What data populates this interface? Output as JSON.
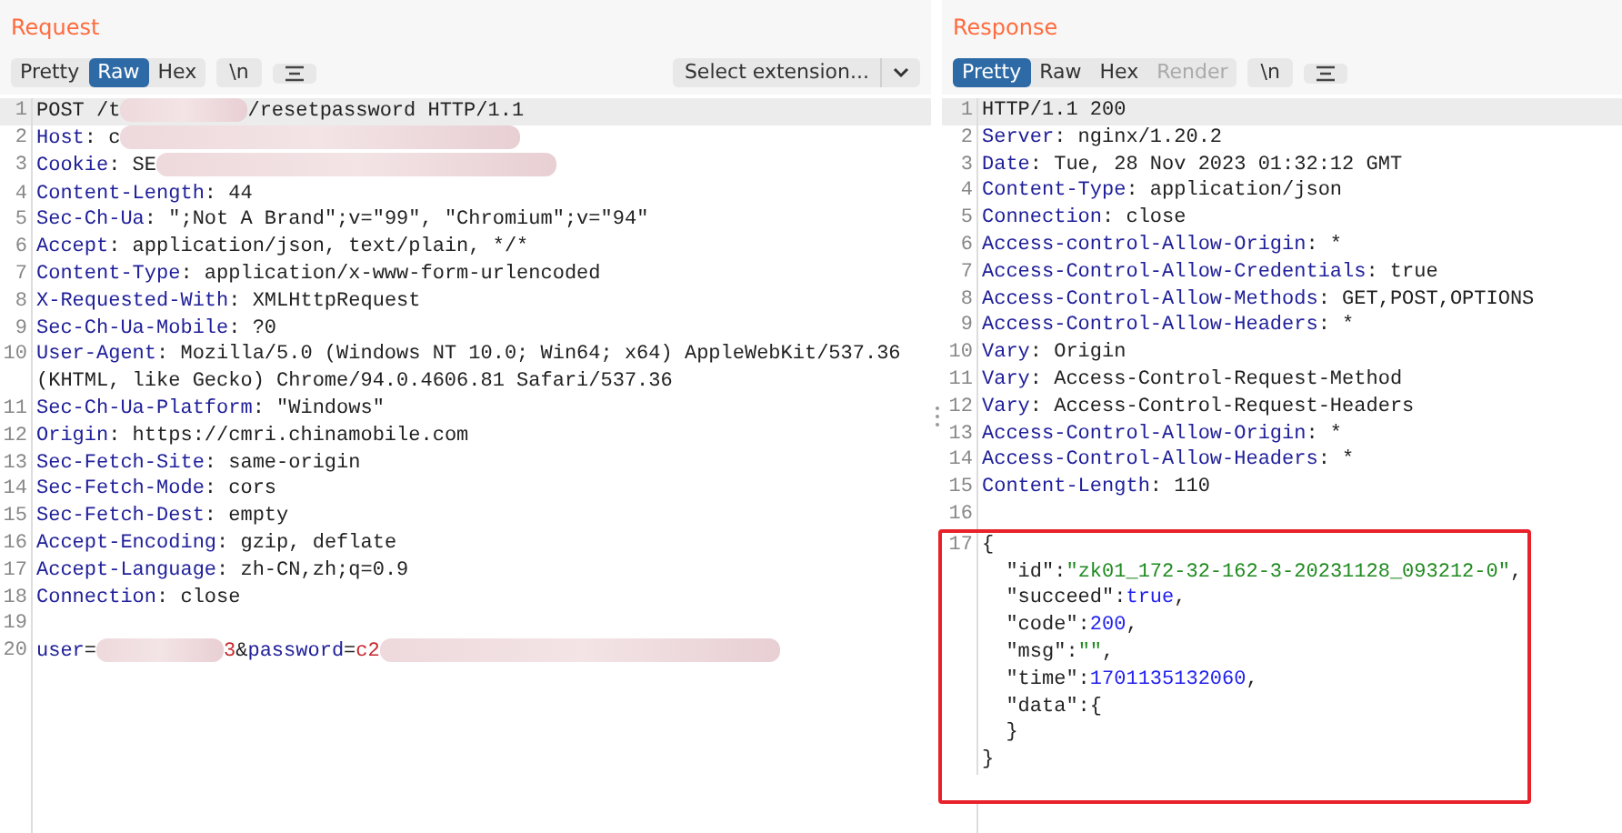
{
  "request": {
    "title": "Request",
    "view_tabs": [
      {
        "label": "Pretty",
        "selected": false,
        "disabled": false
      },
      {
        "label": "Raw",
        "selected": true,
        "disabled": false
      },
      {
        "label": "Hex",
        "selected": false,
        "disabled": false
      }
    ],
    "newline_button": "\\n",
    "extension_select": {
      "value": "Select extension..."
    },
    "lines": [
      {
        "number": "1",
        "current": true,
        "segments": [
          {
            "kind": "plain",
            "text": "POST /t"
          },
          {
            "kind": "redacted"
          },
          {
            "kind": "plain",
            "text": "/resetpassword HTTP/1.1"
          }
        ]
      },
      {
        "number": "2",
        "current": false,
        "segments": [
          {
            "kind": "name",
            "text": "Host"
          },
          {
            "kind": "plain",
            "text": ": c"
          },
          {
            "kind": "redacted"
          }
        ]
      },
      {
        "number": "3",
        "current": false,
        "segments": [
          {
            "kind": "name",
            "text": "Cookie"
          },
          {
            "kind": "plain",
            "text": ": SE"
          },
          {
            "kind": "redacted"
          }
        ]
      },
      {
        "number": "4",
        "current": false,
        "segments": [
          {
            "kind": "name",
            "text": "Content-Length"
          },
          {
            "kind": "plain",
            "text": ": 44"
          }
        ]
      },
      {
        "number": "5",
        "current": false,
        "segments": [
          {
            "kind": "name",
            "text": "Sec-Ch-Ua"
          },
          {
            "kind": "plain",
            "text": ": \";Not A Brand\";v=\"99\", \"Chromium\";v=\"94\""
          }
        ]
      },
      {
        "number": "6",
        "current": false,
        "segments": [
          {
            "kind": "name",
            "text": "Accept"
          },
          {
            "kind": "plain",
            "text": ": application/json, text/plain, */*"
          }
        ]
      },
      {
        "number": "7",
        "current": false,
        "segments": [
          {
            "kind": "name",
            "text": "Content-Type"
          },
          {
            "kind": "plain",
            "text": ": application/x-www-form-urlencoded"
          }
        ]
      },
      {
        "number": "8",
        "current": false,
        "segments": [
          {
            "kind": "name",
            "text": "X-Requested-With"
          },
          {
            "kind": "plain",
            "text": ": XMLHttpRequest"
          }
        ]
      },
      {
        "number": "9",
        "current": false,
        "segments": [
          {
            "kind": "name",
            "text": "Sec-Ch-Ua-Mobile"
          },
          {
            "kind": "plain",
            "text": ": ?0"
          }
        ]
      },
      {
        "number": "10",
        "current": false,
        "segments": [
          {
            "kind": "name",
            "text": "User-Agent"
          },
          {
            "kind": "plain",
            "text": ": Mozilla/5.0 (Windows NT 10.0; Win64; x64) AppleWebKit/537.36"
          }
        ],
        "continuation": [
          [
            {
              "kind": "plain",
              "text": "(KHTML, like Gecko) Chrome/94.0.4606.81 Safari/537.36"
            }
          ]
        ]
      },
      {
        "number": "11",
        "current": false,
        "segments": [
          {
            "kind": "name",
            "text": "Sec-Ch-Ua-Platform"
          },
          {
            "kind": "plain",
            "text": ": \"Windows\""
          }
        ]
      },
      {
        "number": "12",
        "current": false,
        "segments": [
          {
            "kind": "name",
            "text": "Origin"
          },
          {
            "kind": "plain",
            "text": ": https://cmri.chinamobile.com"
          }
        ]
      },
      {
        "number": "13",
        "current": false,
        "segments": [
          {
            "kind": "name",
            "text": "Sec-Fetch-Site"
          },
          {
            "kind": "plain",
            "text": ": same-origin"
          }
        ]
      },
      {
        "number": "14",
        "current": false,
        "segments": [
          {
            "kind": "name",
            "text": "Sec-Fetch-Mode"
          },
          {
            "kind": "plain",
            "text": ": cors"
          }
        ]
      },
      {
        "number": "15",
        "current": false,
        "segments": [
          {
            "kind": "name",
            "text": "Sec-Fetch-Dest"
          },
          {
            "kind": "plain",
            "text": ": empty"
          }
        ]
      },
      {
        "number": "16",
        "current": false,
        "segments": [
          {
            "kind": "name",
            "text": "Accept-Encoding"
          },
          {
            "kind": "plain",
            "text": ": gzip, deflate"
          }
        ]
      },
      {
        "number": "17",
        "current": false,
        "segments": [
          {
            "kind": "name",
            "text": "Accept-Language"
          },
          {
            "kind": "plain",
            "text": ": zh-CN,zh;q=0.9"
          }
        ]
      },
      {
        "number": "18",
        "current": false,
        "segments": [
          {
            "kind": "name",
            "text": "Connection"
          },
          {
            "kind": "plain",
            "text": ": close"
          }
        ]
      },
      {
        "number": "19",
        "current": false
      },
      {
        "number": "20",
        "current": false,
        "segments": [
          {
            "kind": "name",
            "text": "user"
          },
          {
            "kind": "plain",
            "text": "="
          },
          {
            "kind": "redacted"
          },
          {
            "kind": "red",
            "text": "3"
          },
          {
            "kind": "plain",
            "text": "&"
          },
          {
            "kind": "name",
            "text": "password"
          },
          {
            "kind": "plain",
            "text": "="
          },
          {
            "kind": "red",
            "text": "c2"
          },
          {
            "kind": "redacted"
          }
        ]
      }
    ]
  },
  "response": {
    "title": "Response",
    "view_tabs": [
      {
        "label": "Pretty",
        "selected": true,
        "disabled": false
      },
      {
        "label": "Raw",
        "selected": false,
        "disabled": false
      },
      {
        "label": "Hex",
        "selected": false,
        "disabled": false
      },
      {
        "label": "Render",
        "selected": false,
        "disabled": true
      }
    ],
    "newline_button": "\\n",
    "lines": [
      {
        "number": "1",
        "current": true,
        "segments": [
          {
            "kind": "plain",
            "text": "HTTP/1.1 200"
          }
        ]
      },
      {
        "number": "2",
        "current": false,
        "segments": [
          {
            "kind": "name",
            "text": "Server"
          },
          {
            "kind": "plain",
            "text": ": nginx/1.20.2"
          }
        ]
      },
      {
        "number": "3",
        "current": false,
        "segments": [
          {
            "kind": "name",
            "text": "Date"
          },
          {
            "kind": "plain",
            "text": ": Tue, 28 Nov 2023 01:32:12 GMT"
          }
        ]
      },
      {
        "number": "4",
        "current": false,
        "segments": [
          {
            "kind": "name",
            "text": "Content-Type"
          },
          {
            "kind": "plain",
            "text": ": application/json"
          }
        ]
      },
      {
        "number": "5",
        "current": false,
        "segments": [
          {
            "kind": "name",
            "text": "Connection"
          },
          {
            "kind": "plain",
            "text": ": close"
          }
        ]
      },
      {
        "number": "6",
        "current": false,
        "segments": [
          {
            "kind": "name",
            "text": "Access-control-Allow-Origin"
          },
          {
            "kind": "plain",
            "text": ": *"
          }
        ]
      },
      {
        "number": "7",
        "current": false,
        "segments": [
          {
            "kind": "name",
            "text": "Access-Control-Allow-Credentials"
          },
          {
            "kind": "plain",
            "text": ": true"
          }
        ]
      },
      {
        "number": "8",
        "current": false,
        "segments": [
          {
            "kind": "name",
            "text": "Access-Control-Allow-Methods"
          },
          {
            "kind": "plain",
            "text": ": GET,POST,OPTIONS"
          }
        ]
      },
      {
        "number": "9",
        "current": false,
        "segments": [
          {
            "kind": "name",
            "text": "Access-Control-Allow-Headers"
          },
          {
            "kind": "plain",
            "text": ": *"
          }
        ]
      },
      {
        "number": "10",
        "current": false,
        "segments": [
          {
            "kind": "name",
            "text": "Vary"
          },
          {
            "kind": "plain",
            "text": ": Origin"
          }
        ]
      },
      {
        "number": "11",
        "current": false,
        "segments": [
          {
            "kind": "name",
            "text": "Vary"
          },
          {
            "kind": "plain",
            "text": ": Access-Control-Request-Method"
          }
        ]
      },
      {
        "number": "12",
        "current": false,
        "segments": [
          {
            "kind": "name",
            "text": "Vary"
          },
          {
            "kind": "plain",
            "text": ": Access-Control-Request-Headers"
          }
        ]
      },
      {
        "number": "13",
        "current": false,
        "segments": [
          {
            "kind": "name",
            "text": "Access-Control-Allow-Origin"
          },
          {
            "kind": "plain",
            "text": ": *"
          }
        ]
      },
      {
        "number": "14",
        "current": false,
        "segments": [
          {
            "kind": "name",
            "text": "Access-Control-Allow-Headers"
          },
          {
            "kind": "plain",
            "text": ": *"
          }
        ]
      },
      {
        "number": "15",
        "current": false,
        "segments": [
          {
            "kind": "name",
            "text": "Content-Length"
          },
          {
            "kind": "plain",
            "text": ": 110"
          }
        ]
      },
      {
        "number": "16",
        "current": false
      },
      {
        "number": "17",
        "current": false,
        "outlined": true,
        "segments": [
          {
            "kind": "plain",
            "text": "{"
          }
        ],
        "continuation": [
          [
            {
              "kind": "plain",
              "text": "  \"id\":"
            },
            {
              "kind": "string",
              "text": "\"zk01_172-32-162-3-20231128_093212-0\""
            },
            {
              "kind": "plain",
              "text": ","
            }
          ],
          [
            {
              "kind": "plain",
              "text": "  \"succeed\":"
            },
            {
              "kind": "number",
              "text": "true"
            },
            {
              "kind": "plain",
              "text": ","
            }
          ],
          [
            {
              "kind": "plain",
              "text": "  \"code\":"
            },
            {
              "kind": "number",
              "text": "200"
            },
            {
              "kind": "plain",
              "text": ","
            }
          ],
          [
            {
              "kind": "plain",
              "text": "  \"msg\":"
            },
            {
              "kind": "string",
              "text": "\"\""
            },
            {
              "kind": "plain",
              "text": ","
            }
          ],
          [
            {
              "kind": "plain",
              "text": "  \"time\":"
            },
            {
              "kind": "number",
              "text": "1701135132060"
            },
            {
              "kind": "plain",
              "text": ","
            }
          ],
          [
            {
              "kind": "plain",
              "text": "  \"data\":{"
            }
          ],
          [
            {
              "kind": "plain",
              "text": "  }"
            }
          ],
          [
            {
              "kind": "plain",
              "text": "}"
            }
          ]
        ]
      }
    ]
  }
}
